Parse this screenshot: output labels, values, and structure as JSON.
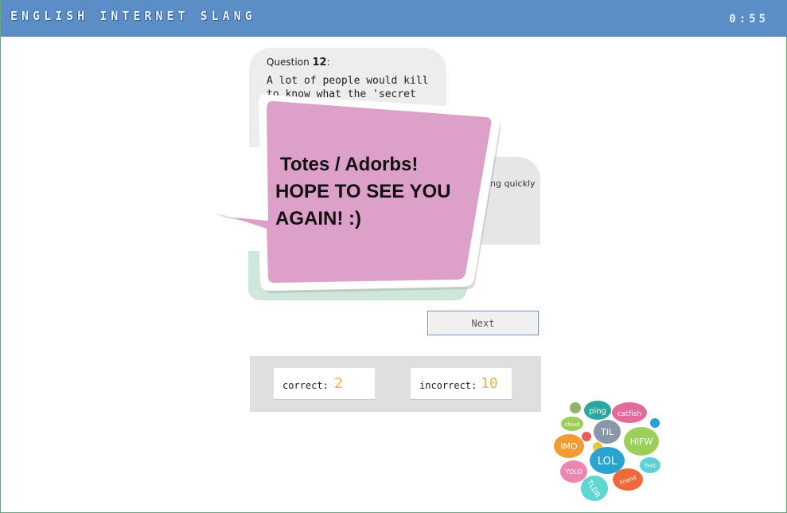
{
  "header": {
    "title": "ENGLISH INTERNET SLANG",
    "timer": "0:55"
  },
  "question": {
    "label": "Question",
    "number": "12",
    "suffix": ":",
    "text_line1": "A lot of people would kill",
    "text_line2": "to know what the 'secret"
  },
  "answer_peek": "ing quickly",
  "popup": {
    "line1": "Totes / Adorbs!",
    "line2": "HOPE TO SEE YOU",
    "line3": "AGAIN! :)"
  },
  "next_label": "Next",
  "score": {
    "correct_label": "correct:",
    "correct_value": "2",
    "incorrect_label": "incorrect:",
    "incorrect_value": "10"
  },
  "slang_cloud": {
    "words": [
      "ping",
      "catfish",
      "cloud",
      "TIL",
      "IMO",
      "HIFW",
      "LOL",
      "YOLO",
      "THX",
      "TLDR",
      "Friend"
    ]
  },
  "colors": {
    "header_bg": "#5b8ec6",
    "popup_pink": "#dda1c9",
    "score_accent": "#f0b24a"
  }
}
